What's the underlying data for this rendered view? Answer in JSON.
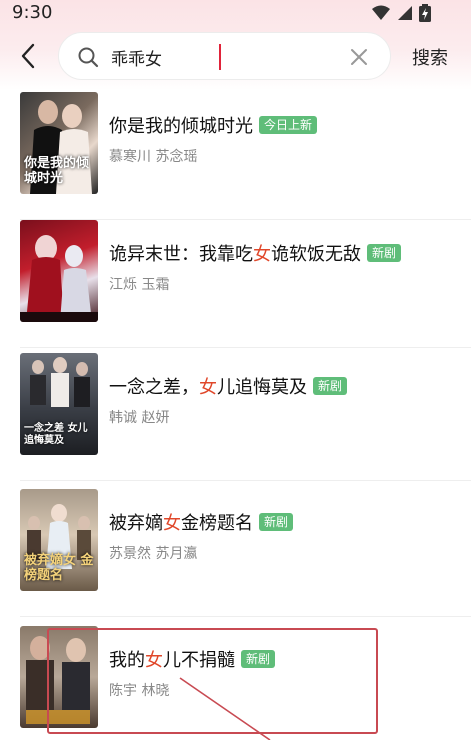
{
  "status": {
    "time": "9:30"
  },
  "search": {
    "query": "乖乖女",
    "button_label": "搜索"
  },
  "results": [
    {
      "title_parts": [
        "你是我的倾城时光"
      ],
      "badge": "今日上新",
      "cast": "慕寒川 苏念瑶",
      "poster_caption": "你是我的倾城时光"
    },
    {
      "title_parts": [
        "诡异末世：我靠吃",
        "女",
        "诡软饭无敌"
      ],
      "badge": "新剧",
      "cast": "江烁 玉霜",
      "poster_caption": ""
    },
    {
      "title_parts": [
        "一念之差，",
        "女",
        "儿追悔莫及"
      ],
      "badge": "新剧",
      "cast": "韩诚 赵妍",
      "poster_caption": "一念之差 女儿追悔莫及"
    },
    {
      "title_parts": [
        "被弃嫡",
        "女",
        "金榜题名"
      ],
      "badge": "新剧",
      "cast": "苏景然 苏月瀛",
      "poster_caption": "被弃嫡女 金榜题名"
    },
    {
      "title_parts": [
        "我的",
        "女",
        "儿不捐髓"
      ],
      "badge": "新剧",
      "cast": "陈宇 林晓",
      "poster_caption": ""
    }
  ],
  "colors": {
    "highlight": "#e0472a",
    "badge_bg": "#5fbd79",
    "annotation": "#c84a52"
  }
}
